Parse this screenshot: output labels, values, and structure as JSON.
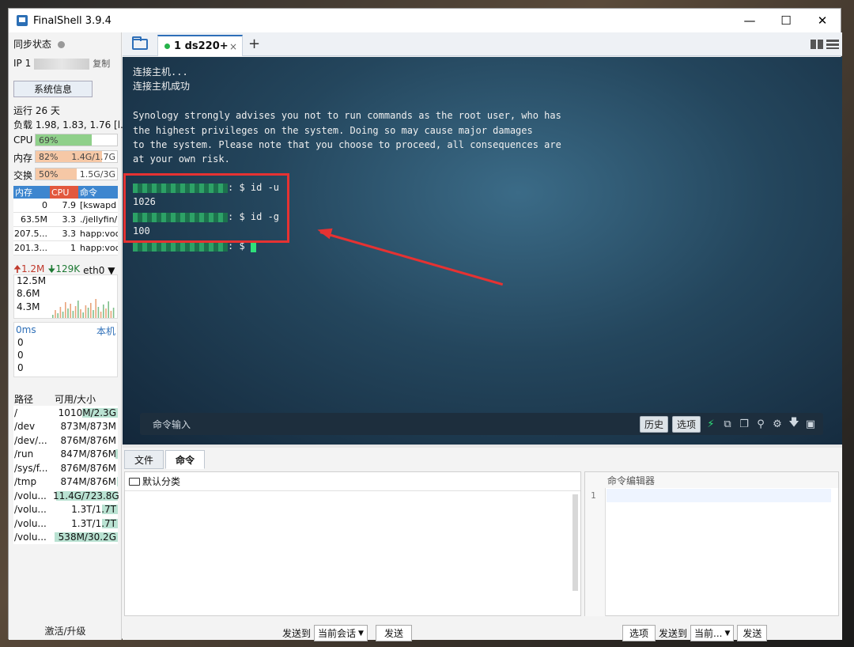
{
  "window": {
    "title": "FinalShell 3.9.4",
    "minimize": "—",
    "maximize": "☐",
    "close": "✕"
  },
  "left": {
    "sync_label": "同步状态",
    "ip_prefix": "IP 1",
    "copy": "复制",
    "sysinfo_btn": "系统信息",
    "uptime": "运行 26 天",
    "load": "负载 1.98, 1.83, 1.76 [l...",
    "cpu": {
      "label": "CPU",
      "pct": "69%",
      "value": 0.69,
      "color": "#8fd08a"
    },
    "mem": {
      "label": "内存",
      "pct": "82%",
      "amount": "1.4G/1.7G",
      "value": 0.82,
      "color": "#f6c8a6"
    },
    "swap": {
      "label": "交换",
      "pct": "50%",
      "amount": "1.5G/3G",
      "value": 0.5,
      "color": "#f6c8a6"
    },
    "proc_headers": [
      "内存",
      "CPU",
      "命令"
    ],
    "processes": [
      {
        "mem": "0",
        "cpu": "7.9",
        "cmd": "[kswapd"
      },
      {
        "mem": "63.5M",
        "cpu": "3.3",
        "cmd": "./jellyfin/"
      },
      {
        "mem": "207.5...",
        "cpu": "3.3",
        "cmd": "happ:voc"
      },
      {
        "mem": "201.3...",
        "cpu": "1",
        "cmd": "happ:voc"
      }
    ],
    "net": {
      "up": "1.2M",
      "down": "129K",
      "iface": "eth0",
      "labels": [
        "12.5M",
        "8.6M",
        "4.3M"
      ]
    },
    "ping": {
      "latency": "0ms",
      "host": "本机",
      "values": [
        "0",
        "0",
        "0"
      ]
    },
    "disk_headers": [
      "路径",
      "可用/大小"
    ],
    "disks": [
      {
        "path": "/",
        "size": "1010M/2.3G",
        "used": 0.55
      },
      {
        "path": "/dev",
        "size": "873M/873M",
        "used": 0.0
      },
      {
        "path": "/dev/...",
        "size": "876M/876M",
        "used": 0.0
      },
      {
        "path": "/run",
        "size": "847M/876M",
        "used": 0.04
      },
      {
        "path": "/sys/f...",
        "size": "876M/876M",
        "used": 0.0
      },
      {
        "path": "/tmp",
        "size": "874M/876M",
        "used": 0.01
      },
      {
        "path": "/volu...",
        "size": "11.4G/723.8G",
        "used": 0.95
      },
      {
        "path": "/volu...",
        "size": "1.3T/1.7T",
        "used": 0.25
      },
      {
        "path": "/volu...",
        "size": "1.3T/1.7T",
        "used": 0.25
      },
      {
        "path": "/volu...",
        "size": "538M/30.2G",
        "used": 0.98
      }
    ],
    "upgrade": "激活/升级"
  },
  "tabs": {
    "session_label": "1 ds220+",
    "close": "×",
    "add": "+"
  },
  "terminal": {
    "lines": [
      "连接主机...",
      "连接主机成功",
      "",
      "Synology strongly advises you not to run commands as the root user, who has",
      "the highest privileges on the system. Doing so may cause major damages",
      "to the system. Please note that you choose to proceed, all consequences are",
      "at your own risk."
    ],
    "prompt_tail_1": ": $ id -u",
    "output_1": "1026",
    "prompt_tail_2": ": $ id -g",
    "output_2": "100",
    "prompt_tail_3": ": $ "
  },
  "cmdbar": {
    "placeholder": "命令输入",
    "history": "历史",
    "options": "选项"
  },
  "bottom": {
    "tab_files": "文件",
    "tab_commands": "命令",
    "category": "默认分类",
    "editor_title": "命令编辑器",
    "line_no": "1",
    "send_to": "发送到",
    "current_session": "当前会话",
    "send": "发送",
    "options": "选项",
    "send_to_2": "发送到",
    "current_2": "当前...",
    "send_2": "发送"
  }
}
